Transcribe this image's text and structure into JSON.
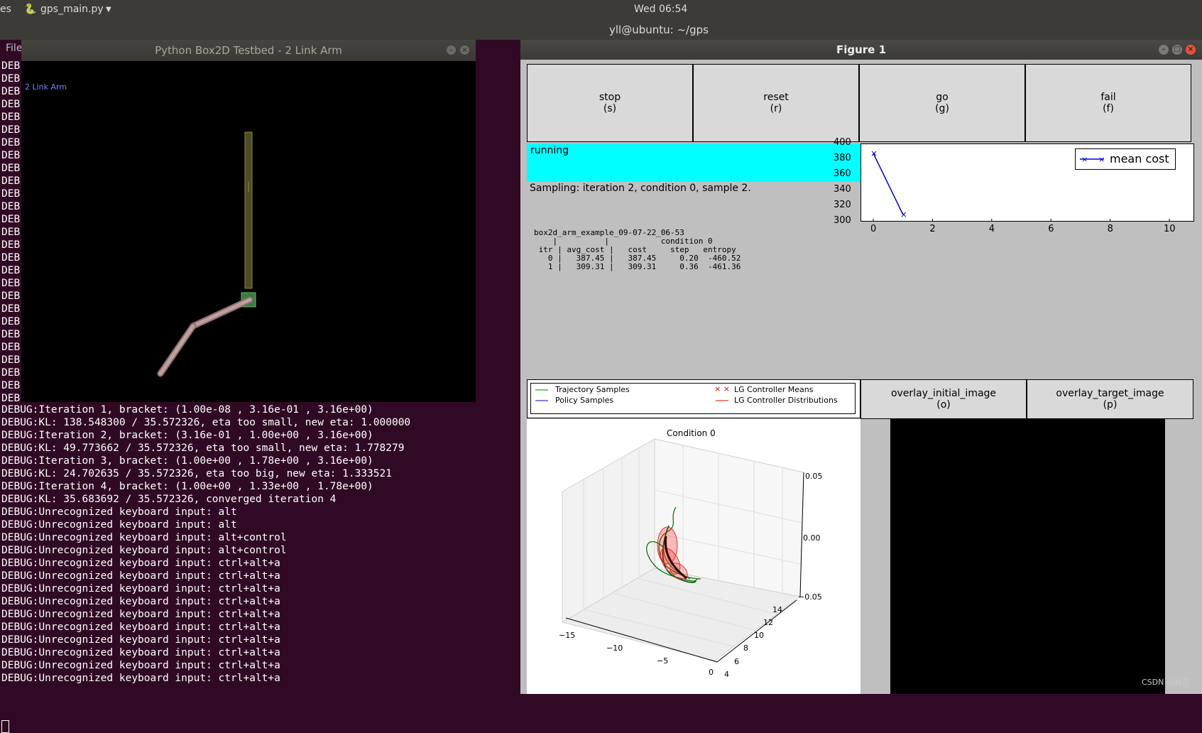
{
  "topbar": {
    "left_text": "es",
    "app_name": "gps_main.py",
    "clock": "Wed 06:54",
    "terminal_title": "yll@ubuntu: ~/gps"
  },
  "terminal": {
    "menu_label": "File",
    "left_prefix": "DEB",
    "left_prefix_count": 27,
    "lines": [
      "DEBUG:Iteration 1, bracket: (1.00e-08 , 3.16e-01 , 3.16e+00)",
      "DEBUG:KL: 138.548300 / 35.572326, eta too small, new eta: 1.000000",
      "DEBUG:KL: 49.773662 / 35.572326, eta too small, new eta: 1.778279",
      "DEBUG:Iteration 3, bracket: (1.00e+00 , 1.78e+00 , 3.16e+00)",
      "DEBUG:KL: 24.702635 / 35.572326, eta too big, new eta: 1.333521",
      "DEBUG:Iteration 4, bracket: (1.00e+00 , 1.33e+00 , 1.78e+00)",
      "DEBUG:KL: 35.683692 / 35.572326, converged iteration 4",
      "DEBUG:Unrecognized keyboard input: alt",
      "DEBUG:Unrecognized keyboard input: alt",
      "DEBUG:Unrecognized keyboard input: alt+control",
      "DEBUG:Unrecognized keyboard input: alt+control",
      "DEBUG:Unrecognized keyboard input: ctrl+alt+a",
      "DEBUG:Unrecognized keyboard input: ctrl+alt+a",
      "DEBUG:Unrecognized keyboard input: ctrl+alt+a",
      "DEBUG:Unrecognized keyboard input: ctrl+alt+a",
      "DEBUG:Unrecognized keyboard input: ctrl+alt+a",
      "DEBUG:Unrecognized keyboard input: ctrl+alt+a",
      "DEBUG:Unrecognized keyboard input: ctrl+alt+a",
      "DEBUG:Unrecognized keyboard input: ctrl+alt+a",
      "DEBUG:Unrecognized keyboard input: ctrl+alt+a",
      "DEBUG:Unrecognized keyboard input: ctrl+alt+a"
    ],
    "line_insert": "DEBUG:Iteration 2, bracket: (3.16e-01 , 1.00e+00 , 3.16e+00)"
  },
  "box2d": {
    "title": "Python Box2D Testbed - 2 Link Arm",
    "label": "2 Link Arm"
  },
  "figure": {
    "title": "Figure 1",
    "buttons": [
      {
        "label": "stop",
        "key": "(s)"
      },
      {
        "label": "reset",
        "key": "(r)"
      },
      {
        "label": "go",
        "key": "(g)"
      },
      {
        "label": "fail",
        "key": "(f)"
      }
    ],
    "status": "running",
    "sampling": "Sampling: iteration 2, condition 0, sample 2.",
    "results_text": "box2d_arm_example_09-07-22_06-53\n    |          |           condition 0\n itr | avg_cost |   cost     step   entropy\n   0 |   387.45 |   387.45     0.20  -460.52\n   1 |   309.31 |   309.31     0.36  -461.36",
    "overlay_initial": {
      "label": "overlay_initial_image",
      "key": "(o)"
    },
    "overlay_target": {
      "label": "overlay_target_image",
      "key": "(p)"
    },
    "traj_legend": {
      "trajectory": "Trajectory Samples",
      "policy": "Policy Samples",
      "means": "LG Controller Means",
      "dists": "LG Controller Distributions"
    },
    "plot3d": {
      "title": "Condition 0",
      "x_ticks": [
        "−15",
        "−10",
        "−5",
        "0"
      ],
      "y_ticks": [
        "4",
        "6",
        "8",
        "10",
        "12",
        "14"
      ],
      "z_ticks": [
        "0.05",
        "0.00",
        "−0.05"
      ]
    }
  },
  "chart_data": {
    "type": "line",
    "series": [
      {
        "name": "mean cost",
        "x": [
          0,
          1
        ],
        "y": [
          387.45,
          309.31
        ]
      }
    ],
    "xlim": [
      -0.5,
      10.5
    ],
    "ylim": [
      300,
      400
    ],
    "x_ticks": [
      0,
      2,
      4,
      6,
      8,
      10
    ],
    "y_ticks": [
      300,
      320,
      340,
      360,
      380,
      400
    ],
    "legend": "top-right",
    "color": "#0000cc"
  },
  "watermark": "CSDN @昇己"
}
